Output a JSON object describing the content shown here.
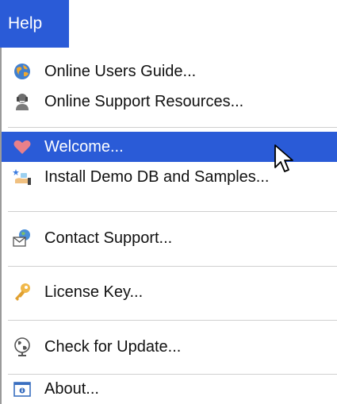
{
  "menubar": {
    "help_label": "Help"
  },
  "menu": {
    "items": [
      {
        "label": "Online Users Guide...",
        "icon": "globe-help-icon"
      },
      {
        "label": "Online Support Resources...",
        "icon": "support-agent-icon"
      },
      {
        "label": "Welcome...",
        "icon": "heart-icon",
        "highlighted": true
      },
      {
        "label": "Install Demo DB and Samples...",
        "icon": "install-samples-icon"
      },
      {
        "label": "Contact Support...",
        "icon": "envelope-globe-icon"
      },
      {
        "label": "License Key...",
        "icon": "key-icon"
      },
      {
        "label": "Check for Update...",
        "icon": "globe-update-icon"
      },
      {
        "label": "About...",
        "icon": "about-window-icon"
      }
    ]
  },
  "colors": {
    "highlight": "#2a5bd7",
    "separator": "#cfcfcf",
    "text": "#111111"
  }
}
